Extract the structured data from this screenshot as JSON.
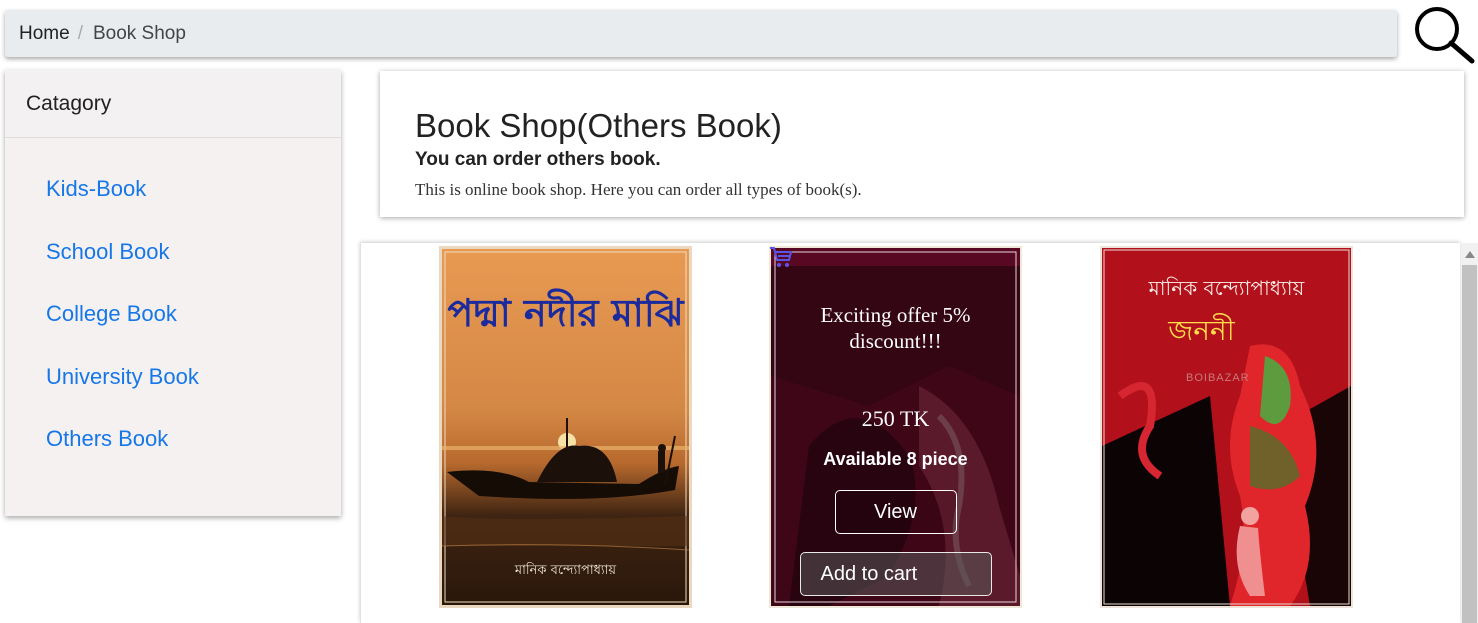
{
  "breadcrumb": {
    "home": "Home",
    "separator": "/",
    "current": "Book Shop"
  },
  "sidebar": {
    "header": "Catagory",
    "items": [
      {
        "label": "Kids-Book"
      },
      {
        "label": "School Book"
      },
      {
        "label": "College Book"
      },
      {
        "label": "University Book"
      },
      {
        "label": "Others Book"
      }
    ]
  },
  "jumbotron": {
    "title": "Book Shop(Others Book)",
    "subtitle": "You can order others book.",
    "description": "This is online book shop. Here you can order all types of book(s)."
  },
  "books": [
    {
      "cover_title": "পদ্মা নদীর মাঝি",
      "cover_author": "মানিক বন্দ্যোপাধ্যায়"
    },
    {
      "offer": "Exciting offer 5% discount!!!",
      "price": "250 TK",
      "stock": "Available 8 piece",
      "view_label": "View",
      "cart_label": "Add to cart"
    },
    {
      "cover_author": "মানিক বন্দ্যোপাধ্যায়",
      "cover_title": "জননী",
      "cover_watermark": "BOIBAZAR"
    }
  ],
  "colors": {
    "link": "#1677e8",
    "breadcrumb_bg": "#e9ecef",
    "sidebar_bg": "#f5f1f1"
  }
}
